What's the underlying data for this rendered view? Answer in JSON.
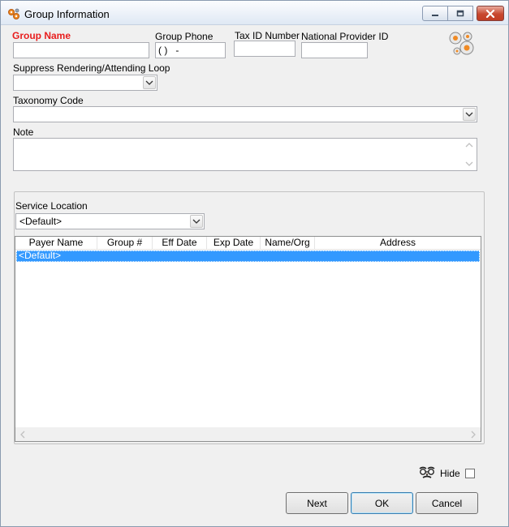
{
  "window": {
    "title": "Group Information",
    "icon": "gear-cluster-icon",
    "controls": [
      "minimize-icon",
      "maximize-icon",
      "close-icon"
    ]
  },
  "fields": {
    "group_name": {
      "label": "Group Name",
      "value": ""
    },
    "group_phone": {
      "label": "Group Phone",
      "value": "( )   -"
    },
    "tax_id": {
      "label": "Tax ID Number",
      "value": ""
    },
    "npi": {
      "label": "National Provider ID",
      "value": ""
    },
    "suppress_loop": {
      "label": "Suppress Rendering/Attending Loop",
      "value": ""
    },
    "taxonomy": {
      "label": "Taxonomy Code",
      "value": ""
    },
    "note": {
      "label": "Note",
      "value": ""
    }
  },
  "service_location": {
    "label": "Service Location",
    "selected": "<Default>"
  },
  "grid": {
    "columns": [
      "Payer Name",
      "Group #",
      "Eff Date",
      "Exp Date",
      "Name/Org",
      "Address"
    ],
    "rows": [
      {
        "payer_name": "<Default>",
        "group": "",
        "eff_date": "",
        "exp_date": "",
        "name_org": "",
        "address": ""
      }
    ]
  },
  "hide": {
    "label": "Hide",
    "checked": false,
    "icon": "disguise-glasses-icon"
  },
  "buttons": {
    "next": "Next",
    "ok": "OK",
    "cancel": "Cancel"
  },
  "colors": {
    "required_label": "#e81e1e",
    "selection": "#3399ff",
    "close_button": "#c8482f"
  }
}
